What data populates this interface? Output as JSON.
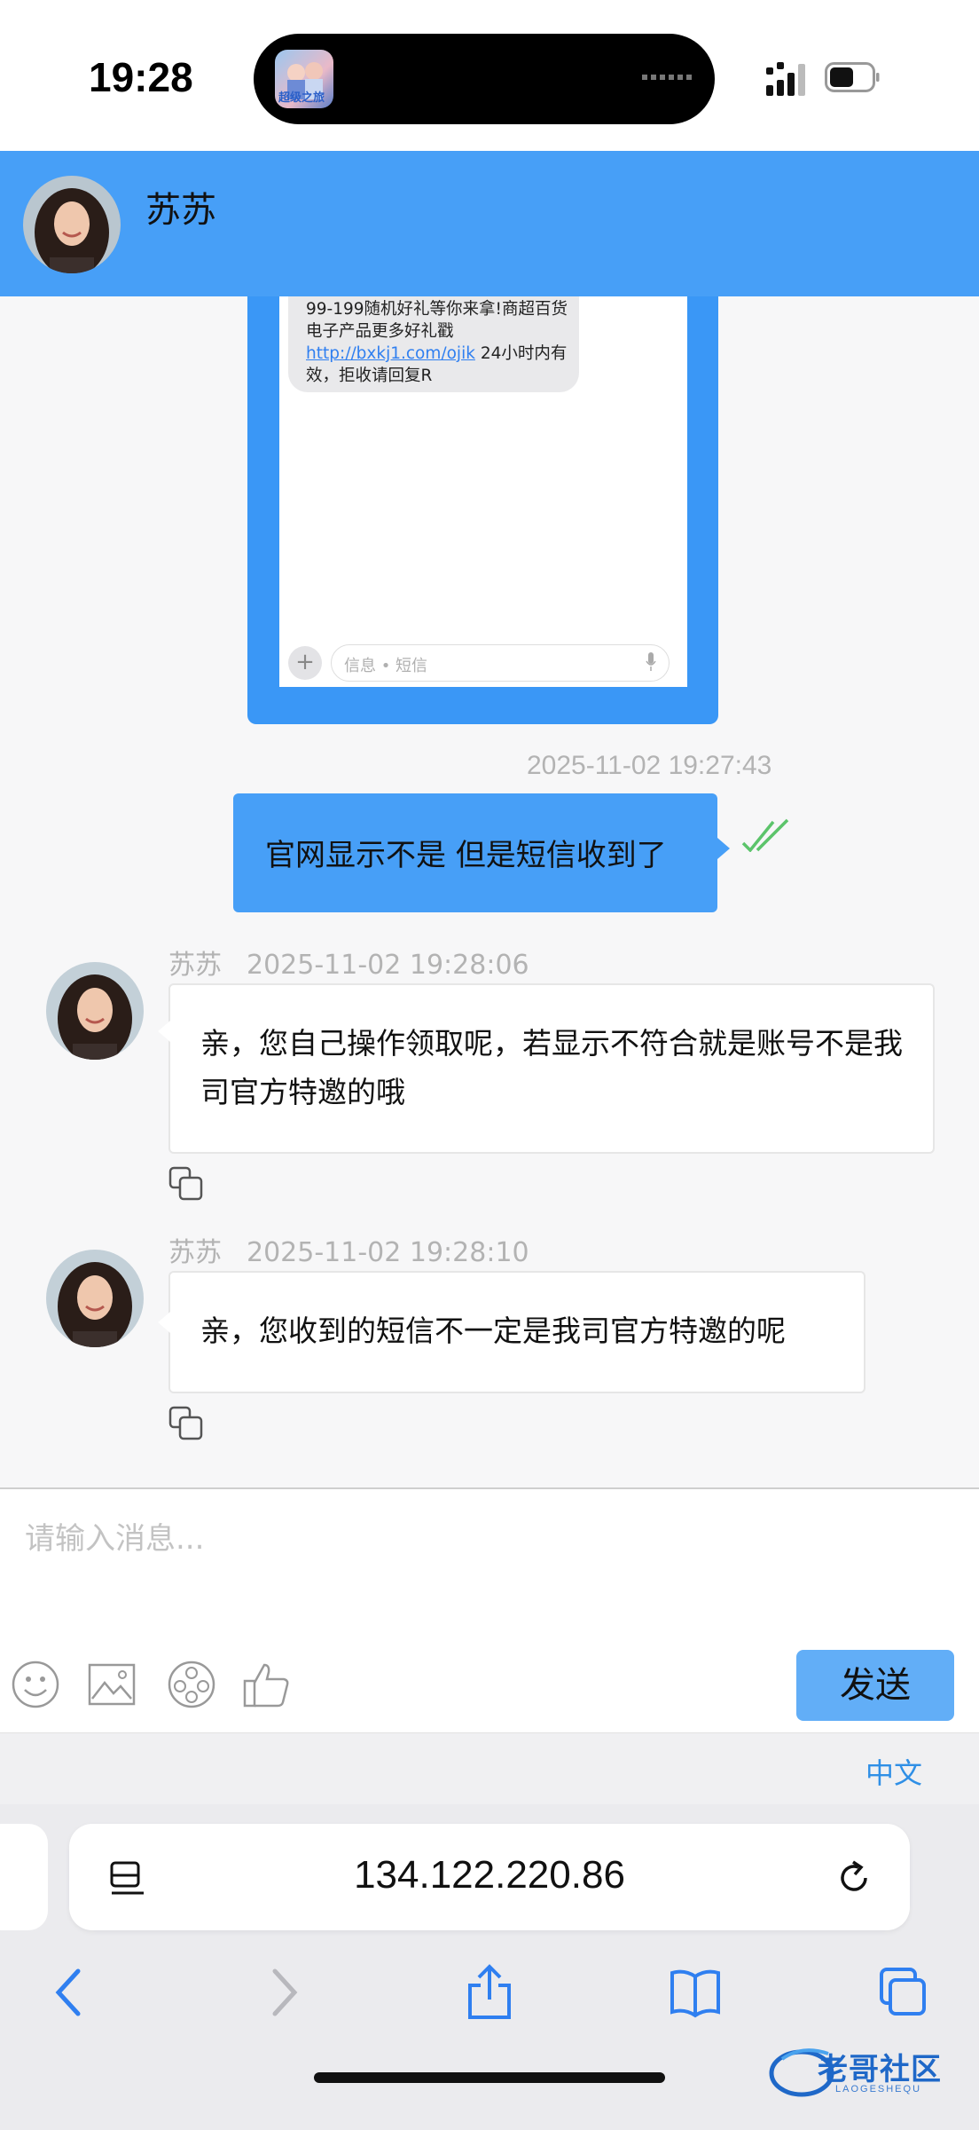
{
  "status_bar": {
    "time": "19:28",
    "island_app_label": "超级之旅"
  },
  "header": {
    "contact_name": "苏苏"
  },
  "embedded_screenshot": {
    "sms_text_before_link": "99-199随机好礼等你来拿!商超百货电子产品更多好礼戳 ",
    "sms_link": "http://bxkj1.com/ojik",
    "sms_text_after_link": " 24小时内有效，拒收请回复R",
    "input_placeholder": "信息 • 短信"
  },
  "messages": [
    {
      "direction": "out",
      "timestamp": "2025-11-02 19:27:43",
      "text": "官网显示不是 但是短信收到了",
      "status": "read"
    },
    {
      "direction": "in",
      "sender": "苏苏",
      "timestamp": "2025-11-02 19:28:06",
      "text": "亲，您自己操作领取呢，若显示不符合就是账号不是我司官方特邀的哦"
    },
    {
      "direction": "in",
      "sender": "苏苏",
      "timestamp": "2025-11-02 19:28:10",
      "text": "亲，您收到的短信不一定是我司官方特邀的呢"
    }
  ],
  "composer": {
    "placeholder": "请输入消息...",
    "tools": [
      "emoji-icon",
      "image-icon",
      "video-icon",
      "thumbs-up-icon"
    ],
    "send_label": "发送"
  },
  "language": {
    "label": "中文"
  },
  "browser": {
    "url": "134.122.220.86",
    "nav_icons": [
      "back-icon",
      "forward-icon",
      "share-icon",
      "bookmarks-icon",
      "tabs-icon"
    ]
  },
  "watermark": {
    "title": "老哥社区",
    "subtitle": "LAOGESHEQU"
  },
  "colors": {
    "header_blue": "#479ff7",
    "send_button": "#62aef7",
    "read_tick": "#5cc46b",
    "link": "#2f8fe6"
  }
}
